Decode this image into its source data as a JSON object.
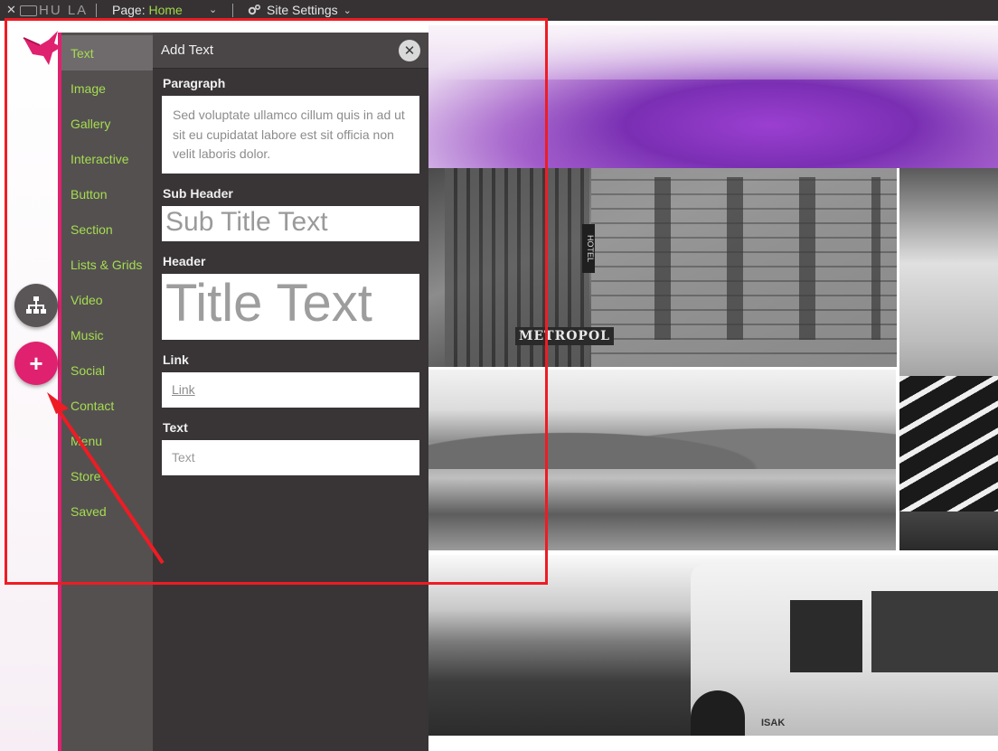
{
  "topbar": {
    "logo_text": "HU LA",
    "page_label": "Page:",
    "page_value": "Home",
    "settings_label": "Site Settings"
  },
  "categories": [
    {
      "label": "Text",
      "active": true
    },
    {
      "label": "Image"
    },
    {
      "label": "Gallery"
    },
    {
      "label": "Interactive"
    },
    {
      "label": "Button"
    },
    {
      "label": "Section"
    },
    {
      "label": "Lists & Grids"
    },
    {
      "label": "Video"
    },
    {
      "label": "Music"
    },
    {
      "label": "Social"
    },
    {
      "label": "Contact"
    },
    {
      "label": "Menu"
    },
    {
      "label": "Store"
    },
    {
      "label": "Saved"
    }
  ],
  "panel": {
    "title": "Add Text",
    "paragraph": {
      "label": "Paragraph",
      "sample": "Sed voluptate ullamco cillum quis in ad ut sit eu cupidatat labore est sit officia non velit laboris dolor."
    },
    "subheader": {
      "label": "Sub Header",
      "sample": "Sub Title Text"
    },
    "header": {
      "label": "Header",
      "sample": "Title Text"
    },
    "link": {
      "label": "Link",
      "sample": "Link"
    },
    "text": {
      "label": "Text",
      "sample": "Text"
    }
  },
  "photos": {
    "street_sign": "METROPOL",
    "hotel_sign": "HOTEL",
    "jeep_brand": "ISAK"
  },
  "colors": {
    "accent_green": "#a5dd4f",
    "accent_pink": "#e0216f",
    "annotation_red": "#ee1c24",
    "panel_dark": "#393536"
  }
}
